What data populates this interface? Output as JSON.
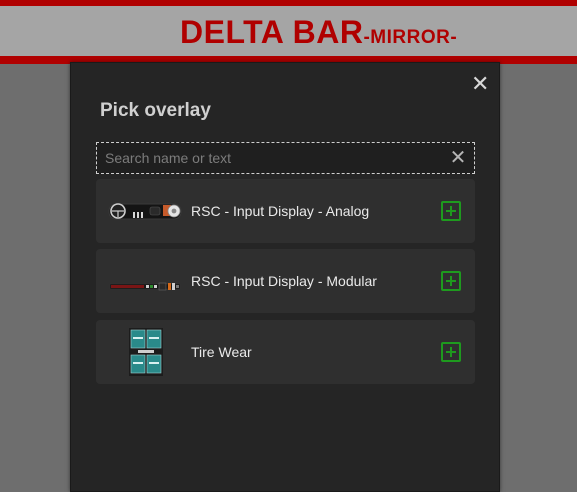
{
  "banner": {
    "title": "DELTA BAR",
    "subtitle": "-MIRROR-",
    "accent_color": "#b00000"
  },
  "dialog": {
    "title": "Pick overlay",
    "close_icon": "close-icon",
    "search": {
      "placeholder": "Search name or text",
      "value": "",
      "clear_icon": "clear-search-icon"
    },
    "items": [
      {
        "label": "RSC - Input Display - Analog",
        "thumbnail": "input-display-analog-thumbnail",
        "action_icon": "add-icon"
      },
      {
        "label": "RSC - Input Display - Modular",
        "thumbnail": "input-display-modular-thumbnail",
        "action_icon": "add-icon"
      },
      {
        "label": "Tire Wear",
        "thumbnail": "tire-wear-thumbnail",
        "action_icon": "add-icon"
      }
    ],
    "add_color": "#1e9a1e"
  }
}
